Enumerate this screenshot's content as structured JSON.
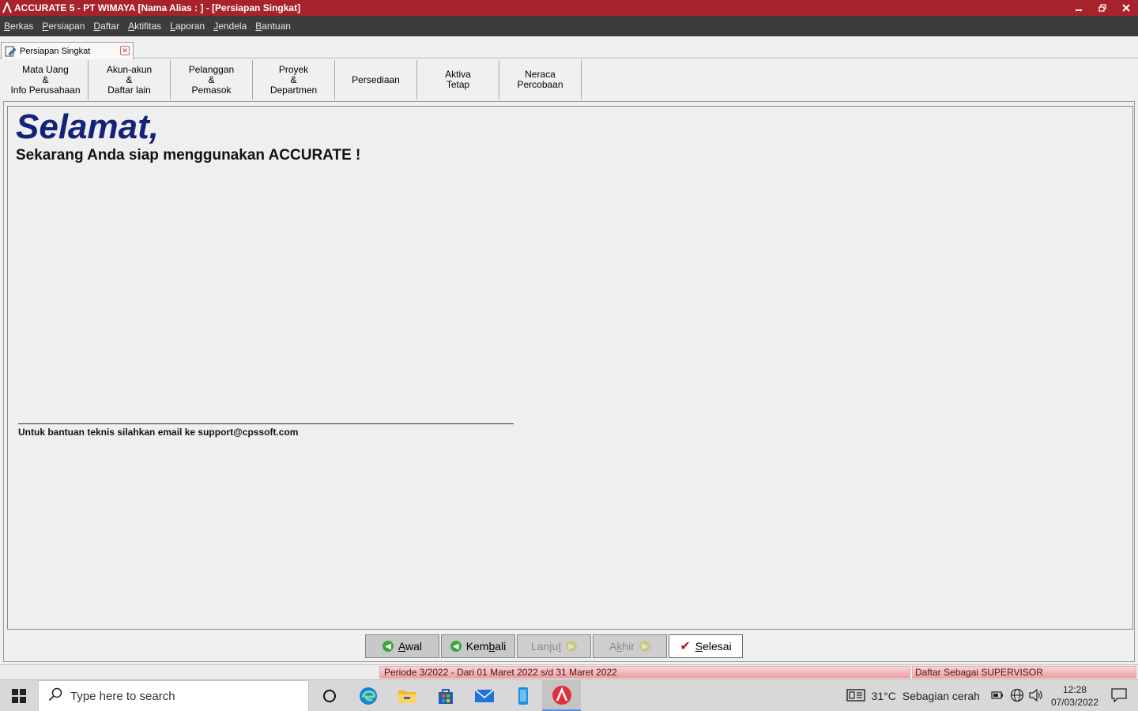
{
  "window": {
    "title": "ACCURATE 5  - PT WIMAYA  [Nama Alias : ] - [Persiapan Singkat]"
  },
  "menu": {
    "items": [
      {
        "label": "Berkas",
        "accel": "B",
        "rest": "erkas"
      },
      {
        "label": "Persiapan",
        "accel": "P",
        "rest": "ersiapan"
      },
      {
        "label": "Daftar",
        "accel": "D",
        "rest": "aftar"
      },
      {
        "label": "Aktifitas",
        "accel": "A",
        "rest": "ktifitas"
      },
      {
        "label": "Laporan",
        "accel": "L",
        "rest": "aporan"
      },
      {
        "label": "Jendela",
        "accel": "J",
        "rest": "endela"
      },
      {
        "label": "Bantuan",
        "accel": "B",
        "rest": "antuan"
      }
    ]
  },
  "doc_tab": {
    "label": "Persiapan Singkat"
  },
  "steps": [
    {
      "label": "Mata Uang\n&\nInfo Perusahaan"
    },
    {
      "label": "Akun-akun\n&\nDaftar lain"
    },
    {
      "label": "Pelanggan\n&\nPemasok"
    },
    {
      "label": "Proyek\n&\nDepartmen"
    },
    {
      "label": "Persediaan"
    },
    {
      "label": "Aktiva\nTetap"
    },
    {
      "label": "Neraca\nPercobaan"
    }
  ],
  "content": {
    "title": "Selamat,",
    "subtitle": "Sekarang Anda siap menggunakan ACCURATE !",
    "support": "Untuk bantuan teknis silahkan email ke support@cpssoft.com"
  },
  "nav_buttons": {
    "awal": {
      "accel": "A",
      "rest": "wal",
      "pre": "",
      "enabled": true
    },
    "kembali": {
      "pre": "Kem",
      "accel": "b",
      "rest": "ali",
      "enabled": true
    },
    "lanjut": {
      "pre": "Lanju",
      "accel": "t",
      "rest": "",
      "enabled": false
    },
    "akhir": {
      "pre": "A",
      "accel": "k",
      "rest": "hir",
      "enabled": false
    },
    "selesai": {
      "pre": "",
      "accel": "S",
      "rest": "elesai",
      "enabled": true
    }
  },
  "status": {
    "periode": "Periode 3/2022 - Dari 01 Maret 2022 s/d 31 Maret 2022",
    "user": "Daftar Sebagai SUPERVISOR"
  },
  "taskbar": {
    "search_placeholder": "Type here to search",
    "weather_temp": "31°C",
    "weather_desc": "Sebagian cerah",
    "time": "12:28",
    "date": "07/03/2022",
    "apps": [
      "cortana-icon",
      "edge-icon",
      "file-explorer-icon",
      "store-icon",
      "mail-icon",
      "phone-link-icon",
      "accurate-icon"
    ]
  },
  "colors": {
    "titlebar": "#a8222b",
    "menubar": "#3c3c3c",
    "greeting": "#14237a",
    "status_bg": "#ec9ea2"
  }
}
